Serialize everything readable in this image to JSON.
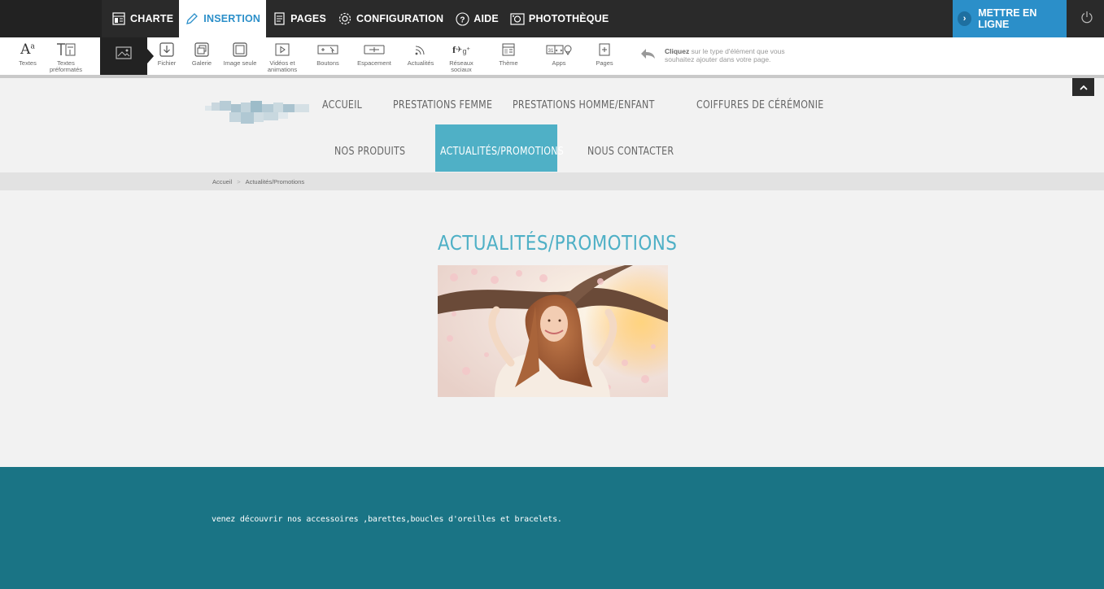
{
  "topbar": {
    "menu": [
      {
        "label": "CHARTE",
        "icon": "layout-icon"
      },
      {
        "label": "INSERTION",
        "icon": "pencil-icon",
        "active": true
      },
      {
        "label": "PAGES",
        "icon": "pages-icon"
      },
      {
        "label": "CONFIGURATION",
        "icon": "gear-icon"
      },
      {
        "label": "AIDE",
        "icon": "help-icon"
      },
      {
        "label": "PHOTOTHÈQUE",
        "icon": "camera-icon"
      }
    ],
    "publish_label": "METTRE EN LIGNE"
  },
  "toolbar": {
    "tools": [
      {
        "label": "Textes",
        "icon": "text-icon"
      },
      {
        "label": "Textes\npréformatés",
        "icon": "preformatted-text-icon"
      },
      {
        "label": "",
        "icon": "image-icon",
        "active": true
      },
      {
        "label": "Fichier",
        "icon": "file-icon"
      },
      {
        "label": "Galerie",
        "icon": "gallery-icon"
      },
      {
        "label": "Image seule",
        "icon": "single-image-icon"
      },
      {
        "label": "Vidéos et\nanimations",
        "icon": "video-icon"
      },
      {
        "label": "Boutons",
        "icon": "buttons-icon"
      },
      {
        "label": "Espacement",
        "icon": "spacing-icon"
      },
      {
        "label": "Actualités",
        "icon": "rss-icon"
      },
      {
        "label": "Réseaux\nsociaux",
        "icon": "social-icon"
      },
      {
        "label": "Thème",
        "icon": "theme-icon"
      },
      {
        "label": "Apps",
        "icon": "apps-icon"
      },
      {
        "label": "Pages",
        "icon": "page-add-icon"
      }
    ],
    "hint_bold": "Cliquez",
    "hint_line1": " sur le type d'élément que vous",
    "hint_line2": "souhaitez ajouter dans votre page."
  },
  "site": {
    "nav": [
      {
        "label": "ACCUEIL"
      },
      {
        "label": "PRESTATIONS FEMME"
      },
      {
        "label": "PRESTATIONS HOMME/ENFANT"
      },
      {
        "label": "COIFFURES DE CÉRÉMONIE"
      },
      {
        "label": "NOS PRODUITS"
      },
      {
        "label": "ACTUALITÉS/PROMOTIONS",
        "active": true
      },
      {
        "label": "NOUS CONTACTER"
      }
    ],
    "breadcrumb": [
      "Accueil",
      "Actualités/Promotions"
    ],
    "breadcrumb_sep": ">",
    "title": "ACTUALITÉS/PROMOTIONS",
    "footer_text": "venez découvrir nos accessoires ,barettes,boucles d'oreilles et bracelets."
  },
  "colors": {
    "accent": "#4fb0c6",
    "editor_blue": "#2b8fc9",
    "footer": "#1a7485",
    "topbar": "#2a2a2a"
  }
}
